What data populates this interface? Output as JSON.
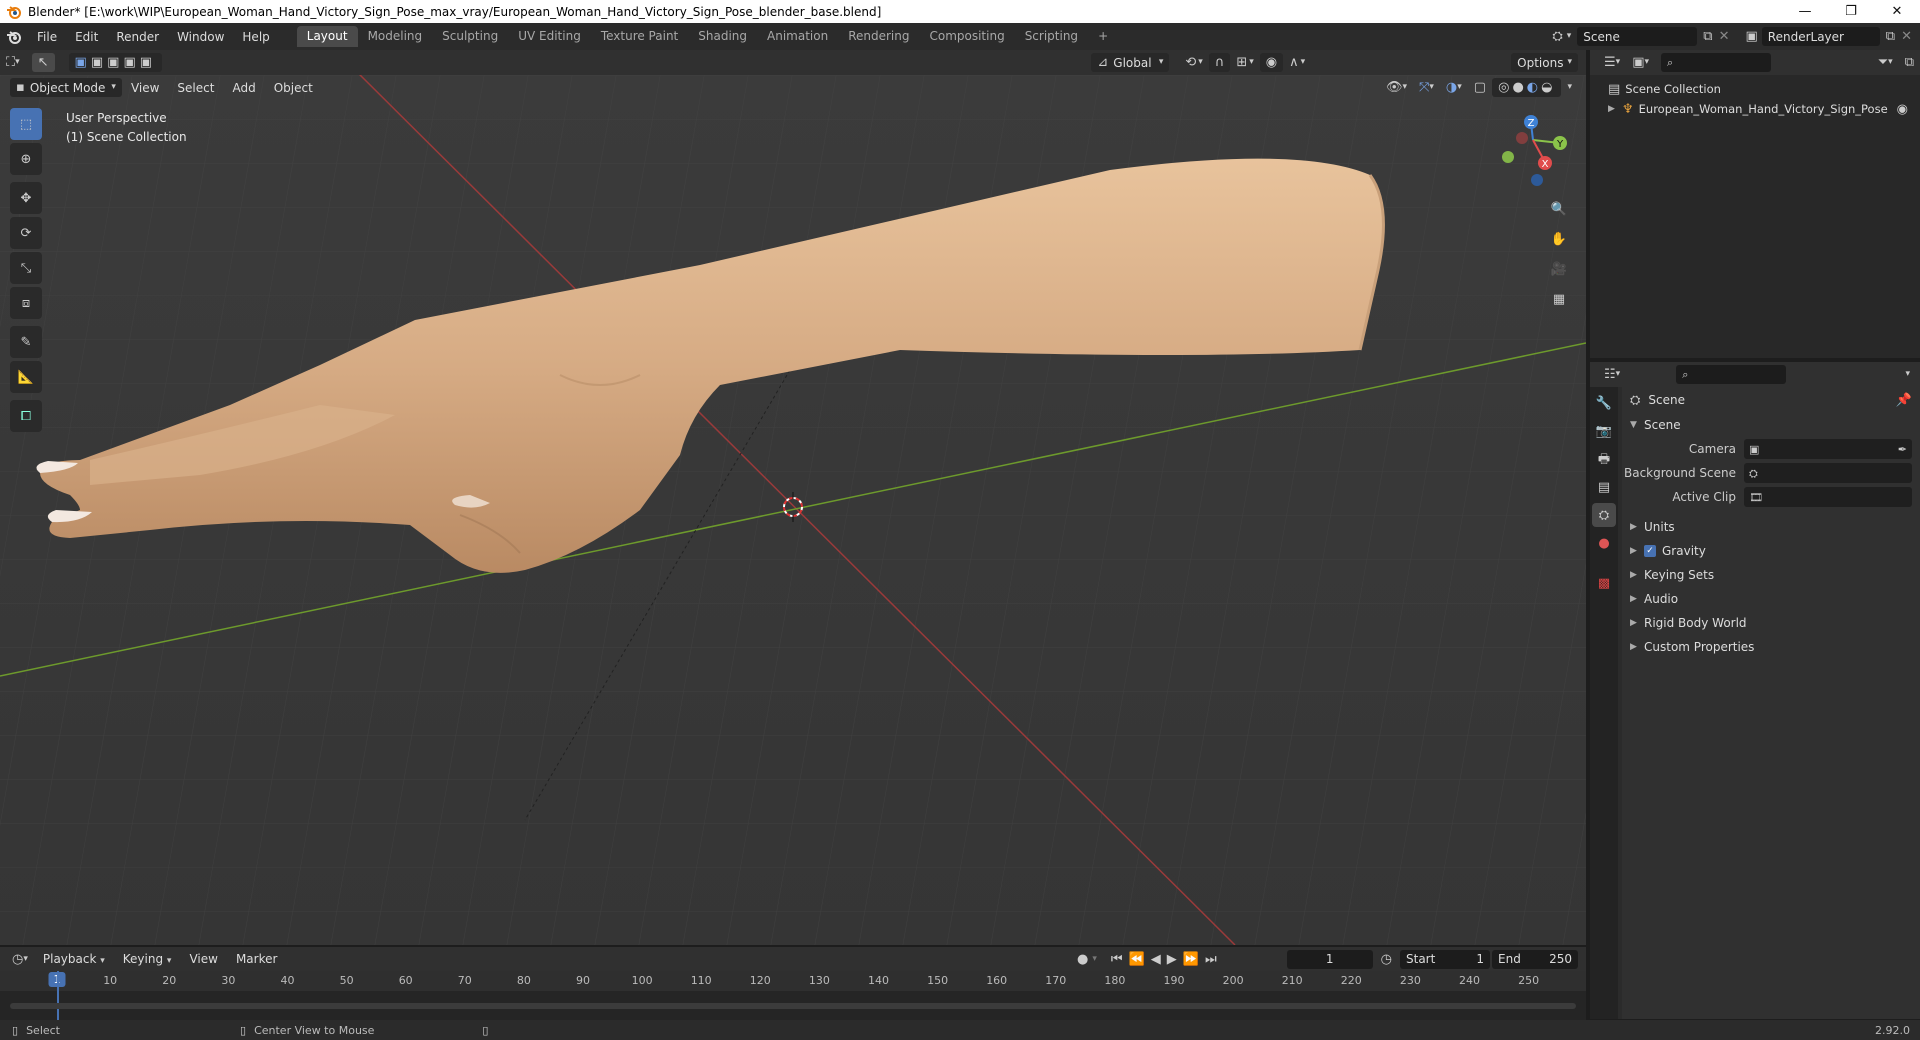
{
  "window": {
    "title": "Blender* [E:\\work\\WIP\\European_Woman_Hand_Victory_Sign_Pose_max_vray/European_Woman_Hand_Victory_Sign_Pose_blender_base.blend]",
    "minimize": "—",
    "maximize": "❐",
    "close": "✕"
  },
  "menu": [
    "File",
    "Edit",
    "Render",
    "Window",
    "Help"
  ],
  "workspaces": [
    {
      "label": "Layout",
      "active": true
    },
    {
      "label": "Modeling"
    },
    {
      "label": "Sculpting"
    },
    {
      "label": "UV Editing"
    },
    {
      "label": "Texture Paint"
    },
    {
      "label": "Shading"
    },
    {
      "label": "Animation"
    },
    {
      "label": "Rendering"
    },
    {
      "label": "Compositing"
    },
    {
      "label": "Scripting"
    }
  ],
  "add_workspace": "+",
  "scene_field": "Scene",
  "renderlayer_field": "RenderLayer",
  "viewport_header": {
    "transform_orientation": "Global",
    "options": "Options"
  },
  "viewport_menu": {
    "mode": "Object Mode",
    "items": [
      "View",
      "Select",
      "Add",
      "Object"
    ]
  },
  "viewport_info": {
    "line1": "User Perspective",
    "line2": "(1) Scene Collection"
  },
  "gizmo": {
    "z": "Z",
    "y": "Y",
    "x": "X"
  },
  "outliner": {
    "root": "Scene Collection",
    "object": "European_Woman_Hand_Victory_Sign_Pose"
  },
  "properties": {
    "context_title": "Scene",
    "panel": "Scene",
    "rows": [
      {
        "label": "Camera"
      },
      {
        "label": "Background Scene"
      },
      {
        "label": "Active Clip"
      }
    ],
    "subpanels": [
      "Units",
      "Gravity",
      "Keying Sets",
      "Audio",
      "Rigid Body World",
      "Custom Properties"
    ],
    "gravity_checked": true
  },
  "timeline": {
    "menus": [
      "Playback",
      "Keying",
      "View",
      "Marker"
    ],
    "current_frame": "1",
    "start_label": "Start",
    "start": "1",
    "end_label": "End",
    "end": "250",
    "ticks": [
      "10",
      "20",
      "30",
      "40",
      "50",
      "60",
      "70",
      "80",
      "90",
      "100",
      "110",
      "120",
      "130",
      "140",
      "150",
      "160",
      "170",
      "180",
      "190",
      "200",
      "210",
      "220",
      "230",
      "240",
      "250"
    ],
    "cur_marker": "1"
  },
  "statusbar": {
    "left": "Select",
    "middle": "Center View to Mouse",
    "version": "2.92.0"
  }
}
